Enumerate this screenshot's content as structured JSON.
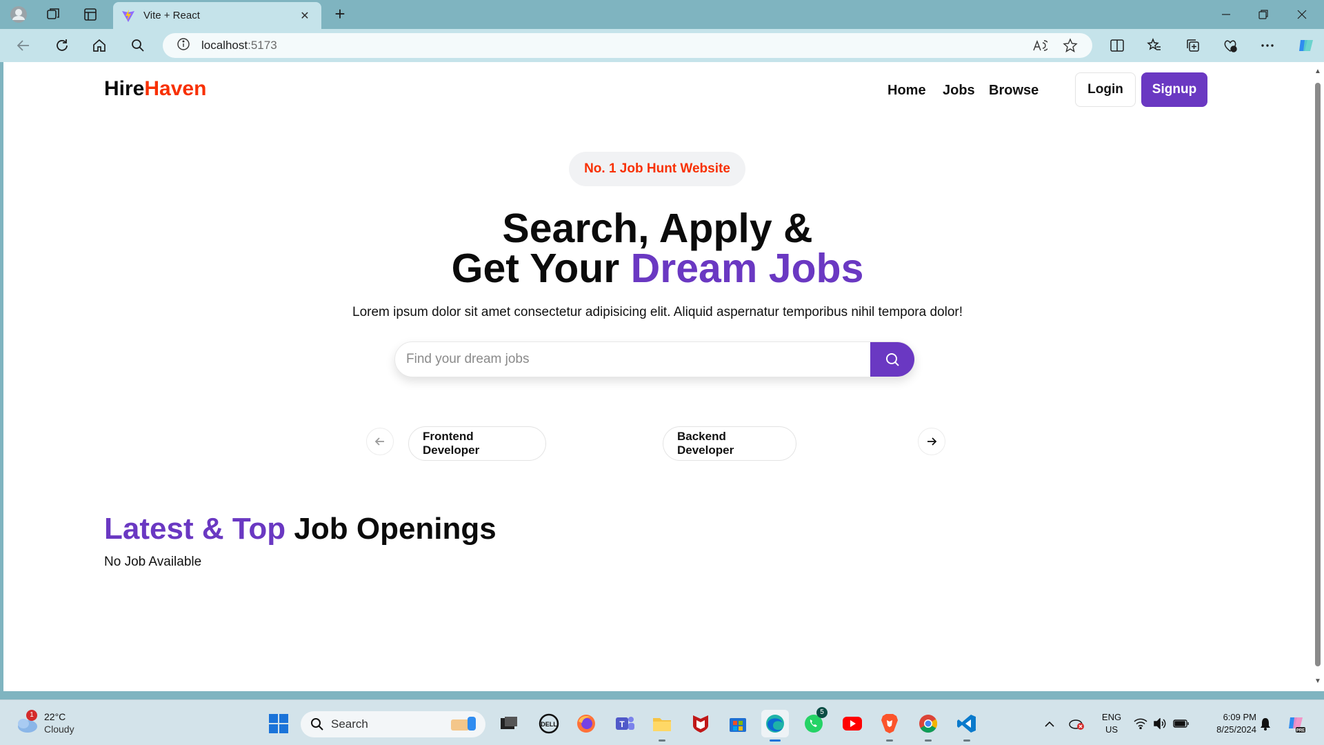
{
  "browser": {
    "tab_title": "Vite + React",
    "address_host": "localhost",
    "address_port": ":5173",
    "new_tab_symbol": "+",
    "tab_close_symbol": "✕"
  },
  "site": {
    "logo_primary": "Hire",
    "logo_accent": "Haven",
    "nav": [
      "Home",
      "Jobs",
      "Browse"
    ],
    "login_label": "Login",
    "signup_label": "Signup"
  },
  "hero": {
    "badge": "No. 1 Job Hunt Website",
    "line1": "Search, Apply &",
    "line2_plain": "Get Your ",
    "line2_accent": "Dream Jobs",
    "lede": "Lorem ipsum dolor sit amet consectetur adipisicing elit. Aliquid aspernatur temporibus nihil tempora dolor!",
    "search_placeholder": "Find your dream jobs"
  },
  "categories": [
    "Frontend Developer",
    "Backend Developer"
  ],
  "openings": {
    "title_accent": "Latest & Top",
    "title_plain": " Job Openings",
    "empty_message": "No Job Available"
  },
  "taskbar": {
    "weather_temp": "22°C",
    "weather_desc": "Cloudy",
    "weather_badge": "1",
    "search_label": "Search",
    "whatsapp_badge": "5",
    "lang_line1": "ENG",
    "lang_line2": "US",
    "time": "6:09 PM",
    "date": "8/25/2024"
  },
  "colors": {
    "brand_purple": "#6a38c2",
    "brand_red": "#f83002",
    "chrome_tab": "#c5e3ea",
    "taskbar": "#d3e3ea"
  },
  "icons": {
    "search_button": "search-icon",
    "prev": "arrow-left-icon",
    "next": "arrow-right-icon"
  }
}
